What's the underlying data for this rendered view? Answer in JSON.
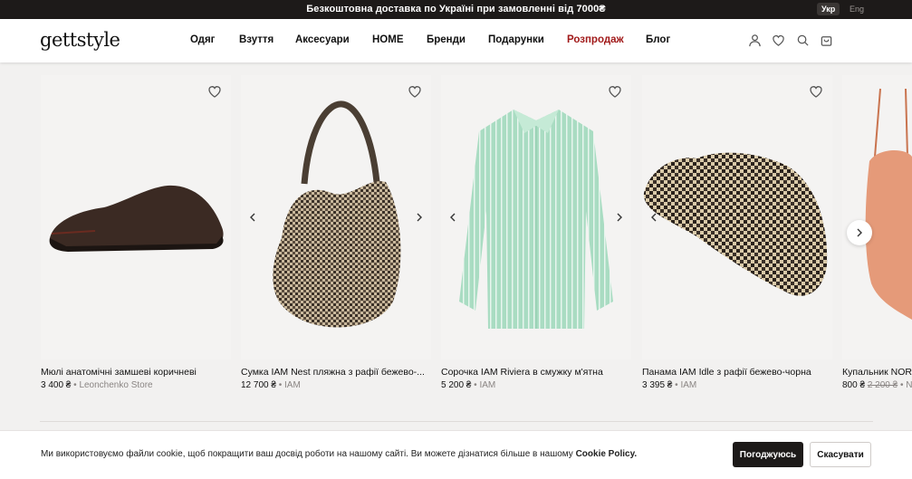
{
  "topbar": {
    "promo": "Безкоштовна доставка по Україні при замовленні від 7000₴",
    "lang_active": "Укр",
    "lang_inactive": "Eng"
  },
  "header": {
    "logo": "gettstyle",
    "nav": [
      "Одяг",
      "Взуття",
      "Аксесуари",
      "HOME",
      "Бренди",
      "Подарунки",
      "Розпродаж",
      "Блог"
    ],
    "sale_color": "#a11a1a",
    "icons": [
      "user-icon",
      "heart-icon",
      "search-icon",
      "bag-icon"
    ]
  },
  "products": [
    {
      "name": "Мюлі анатомічні замшеві коричневі",
      "price": "3 400 ₴",
      "old_price": "",
      "store": "Leonchenko Store"
    },
    {
      "name": "Сумка IAM Nest пляжна з рафії бежево-...",
      "price": "12 700 ₴",
      "old_price": "",
      "store": "IAM"
    },
    {
      "name": "Сорочка  IAM Riviera в смужку м'ятна",
      "price": "5 200 ₴",
      "old_price": "",
      "store": "IAM"
    },
    {
      "name": "Панама IAM Idle з рафії бежево-чорна",
      "price": "3 395 ₴",
      "old_price": "",
      "store": "IAM"
    },
    {
      "name": "Купальник NORE",
      "price": "800 ₴",
      "old_price": "2 200 ₴",
      "store": "N"
    }
  ],
  "cookie": {
    "text": "Ми використовуємо файли cookie, щоб покращити ваш досвід роботи на нашому сайті. Ви можете дізнатися більше в нашому",
    "policy_link": "Cookie Policy.",
    "accept": "Погоджуюсь",
    "cancel": "Скасувати"
  }
}
